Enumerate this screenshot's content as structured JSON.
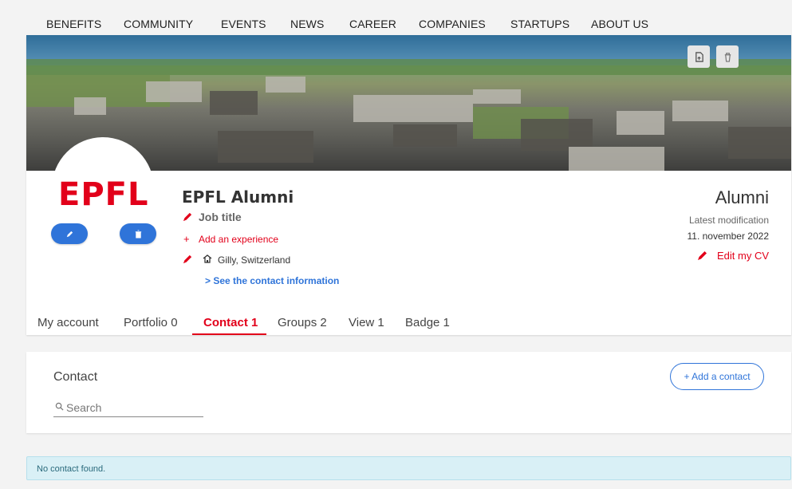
{
  "nav": {
    "items": [
      "BENEFITS",
      "COMMUNITY",
      "EVENTS",
      "NEWS",
      "CAREER",
      "COMPANIES",
      "STARTUPS",
      "ABOUT US"
    ]
  },
  "banner": {
    "buttons": [
      "pdf-export-icon",
      "trash-icon"
    ]
  },
  "profile": {
    "logo_text": "EPFL",
    "name": "EPFL Alumni",
    "job_title": "Job title",
    "add_experience": "Add an experience",
    "location": "Gilly, Switzerland",
    "see_contact": "> See the contact information",
    "type": "Alumni",
    "latest_label": "Latest modification",
    "latest_date": "11. november 2022",
    "edit_cv": "Edit my CV"
  },
  "tabs": [
    {
      "label": "My account",
      "active": false
    },
    {
      "label": "Portfolio 0",
      "active": false
    },
    {
      "label": "Contact 1",
      "active": true
    },
    {
      "label": "Groups 2",
      "active": false
    },
    {
      "label": "View 1",
      "active": false
    },
    {
      "label": "Badge 1",
      "active": false
    }
  ],
  "contact": {
    "title": "Contact",
    "search_placeholder": "Search",
    "add_contact": "+ Add a contact",
    "empty_message": "No contact found."
  },
  "colors": {
    "brand_red": "#e2001a",
    "link_blue": "#2f74d9",
    "alert_bg": "#d9f0f6"
  }
}
